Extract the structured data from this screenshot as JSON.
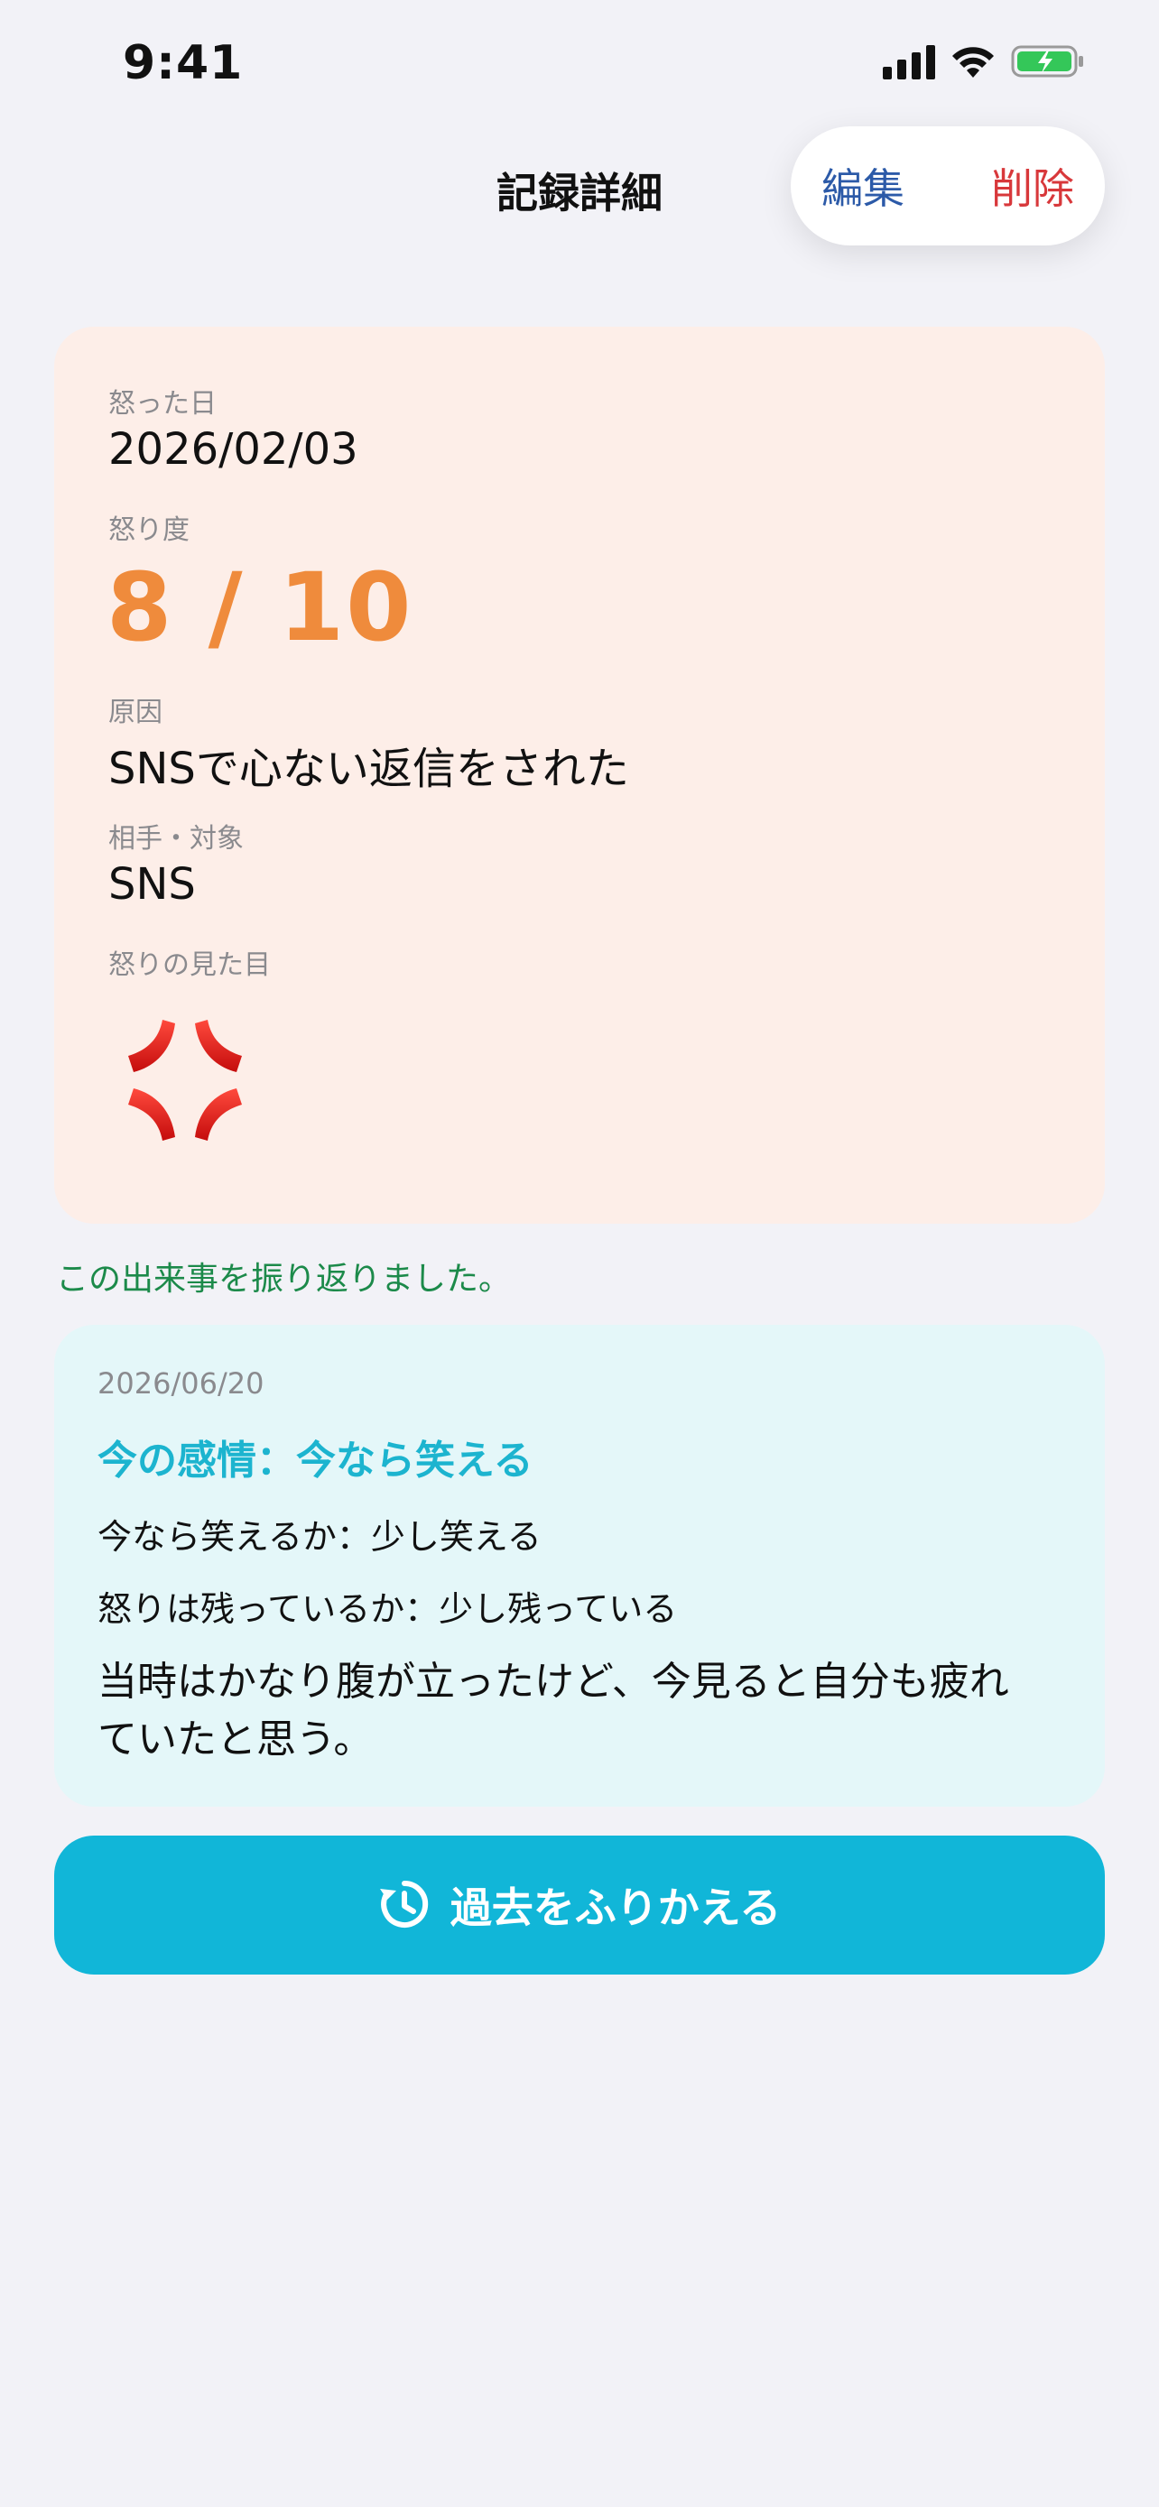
{
  "status_bar": {
    "time": "9:41"
  },
  "nav": {
    "title": "記録詳細",
    "edit_label": "編集",
    "delete_label": "削除"
  },
  "record": {
    "date_label": "怒った日",
    "date_value": "2026/02/03",
    "level_label": "怒り度",
    "level_value": "8 / 10",
    "level_numeric": 8,
    "level_max": 10,
    "cause_label": "原因",
    "cause_value": "SNSで心ない返信をされた",
    "target_label": "相手・対象",
    "target_value": "SNS",
    "appearance_label": "怒りの見た目",
    "appearance_icon": "anger-symbol-icon"
  },
  "reflection_notice": "この出来事を振り返りました。",
  "reflection": {
    "date": "2026/06/20",
    "emotion": "今の感情：今なら笑える",
    "laugh_line": "今なら笑えるか：少し笑える",
    "remain_line": "怒りは残っているか：少し残っている",
    "comment": "当時はかなり腹が立ったけど、今見ると自分も疲れていたと思う。"
  },
  "review_button": {
    "label": "過去をふりかえる",
    "icon": "history-icon"
  },
  "colors": {
    "accent": "#11b6d8",
    "anger_score": "#ef8b3c",
    "delete": "#d8383b",
    "edit": "#2c5aa8",
    "record_card_bg": "#fdeee8",
    "reflection_card_bg": "#e4f7f9",
    "notice_green": "#1c8a4a"
  }
}
